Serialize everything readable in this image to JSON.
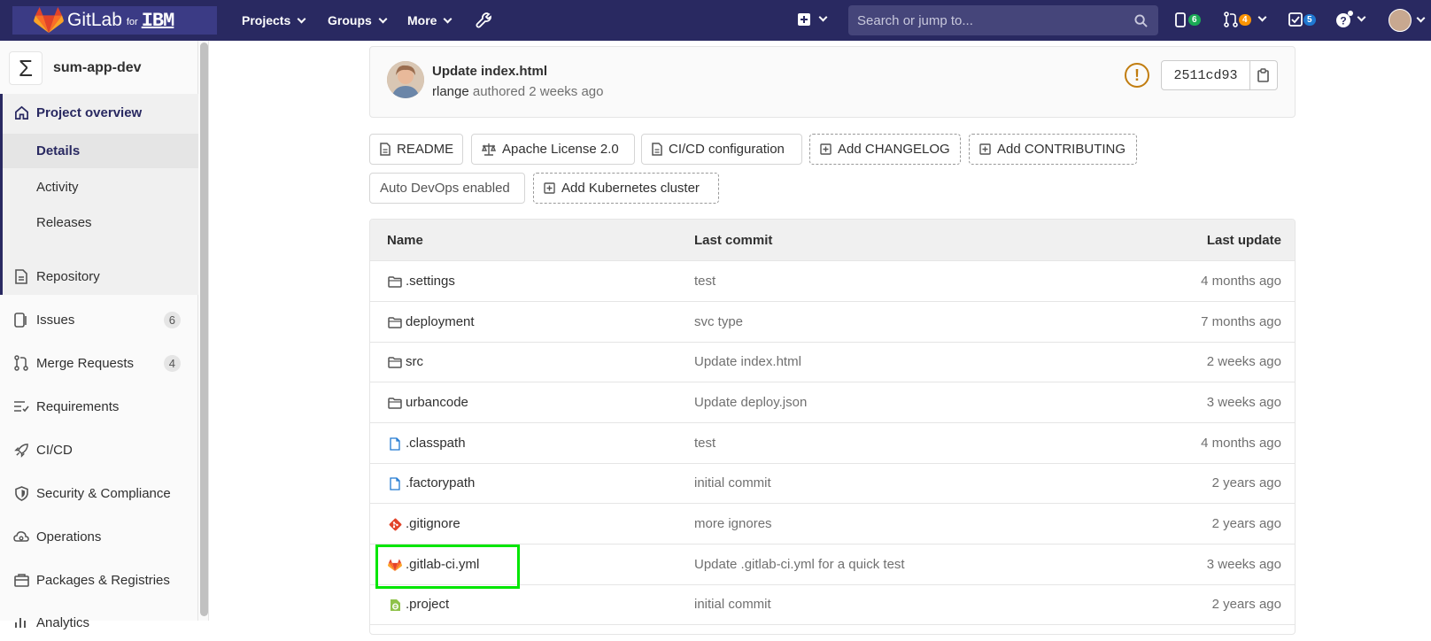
{
  "topbar": {
    "brand": "GitLab",
    "brand_for": "for",
    "brand_ibm": "IBM",
    "nav": [
      {
        "label": "Projects"
      },
      {
        "label": "Groups"
      },
      {
        "label": "More"
      }
    ],
    "search_placeholder": "Search or jump to...",
    "issues_count": "6",
    "mr_count": "4",
    "todo_count": "5",
    "colors": {
      "bg": "#292961",
      "issues_badge": "#1aaa55",
      "mr_badge": "#fc9403",
      "todo_badge": "#1f78d1"
    }
  },
  "sidebar": {
    "project_name": "sum-app-dev",
    "project_avatar_glyph": "Σ",
    "overview_label": "Project overview",
    "sub_items": [
      {
        "label": "Details"
      },
      {
        "label": "Activity"
      },
      {
        "label": "Releases"
      }
    ],
    "items": [
      {
        "label": "Repository",
        "icon": "doc-icon"
      },
      {
        "label": "Issues",
        "icon": "issues-icon",
        "count": "6"
      },
      {
        "label": "Merge Requests",
        "icon": "merge-request-icon",
        "count": "4"
      },
      {
        "label": "Requirements",
        "icon": "requirements-icon"
      },
      {
        "label": "CI/CD",
        "icon": "rocket-icon"
      },
      {
        "label": "Security & Compliance",
        "icon": "shield-icon"
      },
      {
        "label": "Operations",
        "icon": "cloud-gear-icon"
      },
      {
        "label": "Packages & Registries",
        "icon": "package-icon"
      },
      {
        "label": "Analytics",
        "icon": "chart-icon"
      }
    ]
  },
  "commit": {
    "title": "Update index.html",
    "author": "rlange",
    "meta": "authored 2 weeks ago",
    "sha": "2511cd93"
  },
  "buttons": [
    {
      "label": "README"
    },
    {
      "label": "Apache License 2.0"
    },
    {
      "label": "CI/CD configuration"
    },
    {
      "label": "Add CHANGELOG"
    },
    {
      "label": "Add CONTRIBUTING"
    },
    {
      "label": "Auto DevOps enabled"
    },
    {
      "label": "Add Kubernetes cluster"
    }
  ],
  "table": {
    "headers": {
      "name": "Name",
      "last_commit": "Last commit",
      "last_update": "Last update"
    },
    "rows": [
      {
        "name": ".settings",
        "commit": "test",
        "date": "4 months ago",
        "icon": "folder-icon"
      },
      {
        "name": "deployment",
        "commit": "svc type",
        "date": "7 months ago",
        "icon": "folder-icon"
      },
      {
        "name": "src",
        "commit": "Update index.html",
        "date": "2 weeks ago",
        "icon": "folder-icon"
      },
      {
        "name": "urbancode",
        "commit": "Update deploy.json",
        "date": "3 weeks ago",
        "icon": "folder-icon"
      },
      {
        "name": ".classpath",
        "commit": "test",
        "date": "4 months ago",
        "icon": "file-icon"
      },
      {
        "name": ".factorypath",
        "commit": "initial commit",
        "date": "2 years ago",
        "icon": "file-icon"
      },
      {
        "name": ".gitignore",
        "commit": "more ignores",
        "date": "2 years ago",
        "icon": "git-icon"
      },
      {
        "name": ".gitlab-ci.yml",
        "commit": "Update .gitlab-ci.yml for a quick test",
        "date": "3 weeks ago",
        "icon": "gitlab-fox-icon"
      },
      {
        "name": ".project",
        "commit": "initial commit",
        "date": "2 years ago",
        "icon": "eclipse-file-icon"
      }
    ]
  }
}
